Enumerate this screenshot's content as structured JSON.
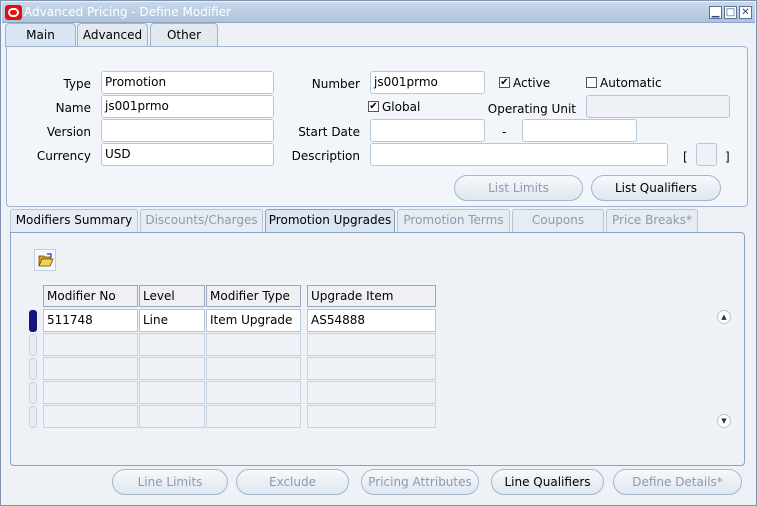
{
  "window": {
    "title": "Advanced Pricing - Define Modifier"
  },
  "controls": {
    "minimize": "▁",
    "maximize": "□",
    "close": "✕"
  },
  "top_tabs": [
    {
      "label": "Main"
    },
    {
      "label": "Advanced"
    },
    {
      "label": "Other"
    }
  ],
  "header": {
    "type_label": "Type",
    "type_value": "Promotion",
    "name_label": "Name",
    "name_value": "js001prmo",
    "version_label": "Version",
    "version_value": "",
    "currency_label": "Currency",
    "currency_value": "USD",
    "number_label": "Number",
    "number_value": "js001prmo",
    "active_label": "Active",
    "active_checked": true,
    "automatic_label": "Automatic",
    "automatic_checked": false,
    "global_label": "Global",
    "global_checked": true,
    "operating_unit_label": "Operating Unit",
    "operating_unit_value": "",
    "start_date_label": "Start Date",
    "start_date_value": "",
    "date_separator": "-",
    "end_date_value": "",
    "description_label": "Description",
    "description_value": "",
    "bracket_open": "[",
    "bracket_close": "]",
    "list_limits_label": "List Limits",
    "list_qualifiers_label": "List Qualifiers"
  },
  "sub_tabs": [
    {
      "label": "Modifiers Summary"
    },
    {
      "label": "Discounts/Charges"
    },
    {
      "label": "Promotion Upgrades"
    },
    {
      "label": "Promotion Terms"
    },
    {
      "label": "Coupons"
    },
    {
      "label": "Price Breaks*"
    }
  ],
  "table": {
    "columns": [
      "Modifier No",
      "Level",
      "Modifier Type",
      "Upgrade Item"
    ],
    "rows": [
      [
        "511748",
        "Line",
        "Item Upgrade",
        "AS54888"
      ],
      [
        "",
        "",
        "",
        ""
      ],
      [
        "",
        "",
        "",
        ""
      ],
      [
        "",
        "",
        "",
        ""
      ],
      [
        "",
        "",
        "",
        ""
      ]
    ]
  },
  "scroll": {
    "up": "▲",
    "down": "▼"
  },
  "footer_buttons": {
    "line_limits": "Line Limits",
    "exclude": "Exclude",
    "pricing_attributes": "Pricing Attributes",
    "line_qualifiers": "Line Qualifiers",
    "define_details": "Define Details*"
  },
  "colors": {
    "accent": "#14147a",
    "oracle_red": "#e01010",
    "title_bar": "#aec3dc"
  }
}
